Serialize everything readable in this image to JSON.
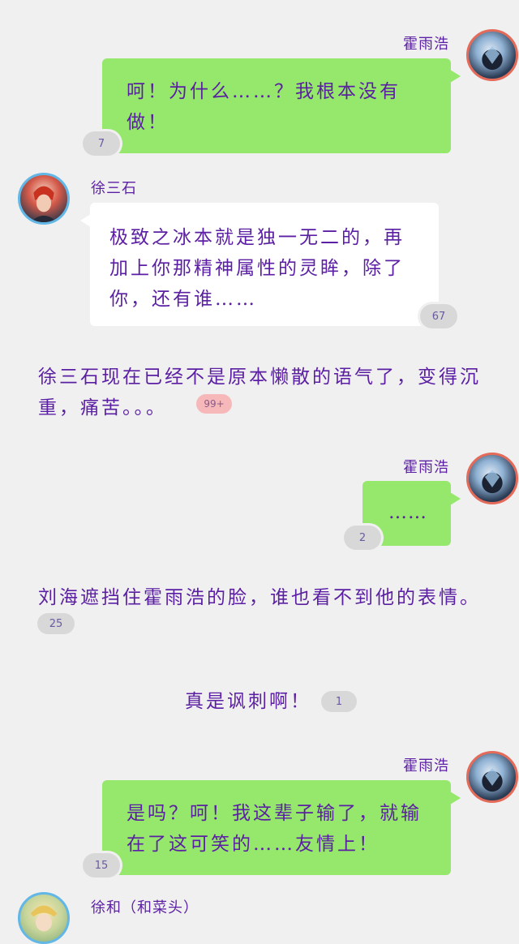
{
  "messages": {
    "m1": {
      "sender": "霍雨浩",
      "text": "呵！为什么……？我根本没有做！",
      "badge": "7"
    },
    "m2": {
      "sender": "徐三石",
      "text": "极致之冰本就是独一无二的，再加上你那精神属性的灵眸，除了你，还有谁……",
      "badge": "67"
    },
    "n1": {
      "text": "徐三石现在已经不是原本懒散的语气了，变得沉重，痛苦。。。",
      "badge": "99+"
    },
    "m3": {
      "sender": "霍雨浩",
      "text": "……",
      "badge": "2"
    },
    "n2": {
      "text": "刘海遮挡住霍雨浩的脸，谁也看不到他的表情。",
      "badge": "25"
    },
    "n3": {
      "text": "真是讽刺啊！",
      "badge": "1"
    },
    "m4": {
      "sender": "霍雨浩",
      "text": "是吗？呵！我这辈子输了，就输在了这可笑的……友情上！",
      "badge": "15"
    },
    "m5": {
      "sender": "徐和（和菜头）"
    }
  },
  "colors": {
    "background": "#f0f0f0",
    "green_bubble": "#95e86b",
    "white_bubble": "#ffffff",
    "text": "#5b1fa3",
    "badge": "#d8d8d8",
    "badge_hot": "#f6b8b8"
  },
  "icons": {
    "avatar_me": "avatar-huo-yuhao-icon",
    "avatar_xu": "avatar-xu-sanshi-icon",
    "avatar_he": "avatar-xu-he-icon"
  }
}
